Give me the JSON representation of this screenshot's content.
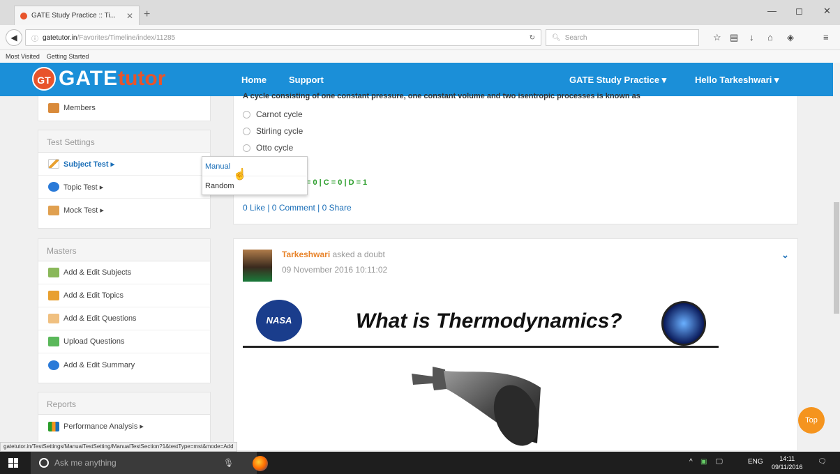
{
  "browser": {
    "tab_title": "GATE Study Practice :: Ti...",
    "tab_close": "✕",
    "new_tab": "+",
    "url_host": "gatetutor.in",
    "url_path": "/Favorites/Timeline/index/11285",
    "search_placeholder": "Search",
    "bookmarks": [
      "Most Visited",
      "Getting Started"
    ],
    "status_url": "gatetutor.in/TestSettings/ManualTestSetting/ManualTestSection?1&testType=mst&mode=Add"
  },
  "header": {
    "logo_badge": "GT",
    "logo_gate": "GATE",
    "logo_tutor": "tutor",
    "nav": [
      "Home",
      "Support"
    ],
    "study_practice": "GATE Study Practice ▾",
    "user_greeting": "Hello Tarkeshwari ▾",
    "brand_color": "#1b8fd8"
  },
  "sidebar": {
    "members_label": "Members",
    "test_settings": {
      "title": "Test Settings",
      "items": [
        "Subject Test ▸",
        "Topic Test ▸",
        "Mock Test ▸"
      ]
    },
    "masters": {
      "title": "Masters",
      "items": [
        "Add & Edit Subjects",
        "Add & Edit Topics",
        "Add & Edit Questions",
        "Upload Questions",
        "Add & Edit Summary"
      ]
    },
    "reports": {
      "title": "Reports",
      "items": [
        "Performance Analysis ▸"
      ]
    }
  },
  "dropdown": {
    "items": [
      "Manual",
      "Random"
    ]
  },
  "post1": {
    "question": "A cycle consisting of one constant pressure, one constant volume and two isentropic processes is known as",
    "options": [
      "Carnot cycle",
      "Stirling cycle",
      "Otto cycle"
    ],
    "answer_counts": "B = 0  |  C = 0  |  D = 1",
    "social": "0 Like | 0 Comment | 0 Share"
  },
  "post2": {
    "author": "Tarkeshwari",
    "verb": "asked a doubt",
    "date": "09 November 2016 10:11:02",
    "image_title": "What is Thermodynamics?",
    "nasa_label": "NASA"
  },
  "top_button": "Top",
  "taskbar": {
    "search_placeholder": "Ask me anything",
    "lang": "ENG",
    "time": "14:11",
    "date": "09/11/2016"
  }
}
